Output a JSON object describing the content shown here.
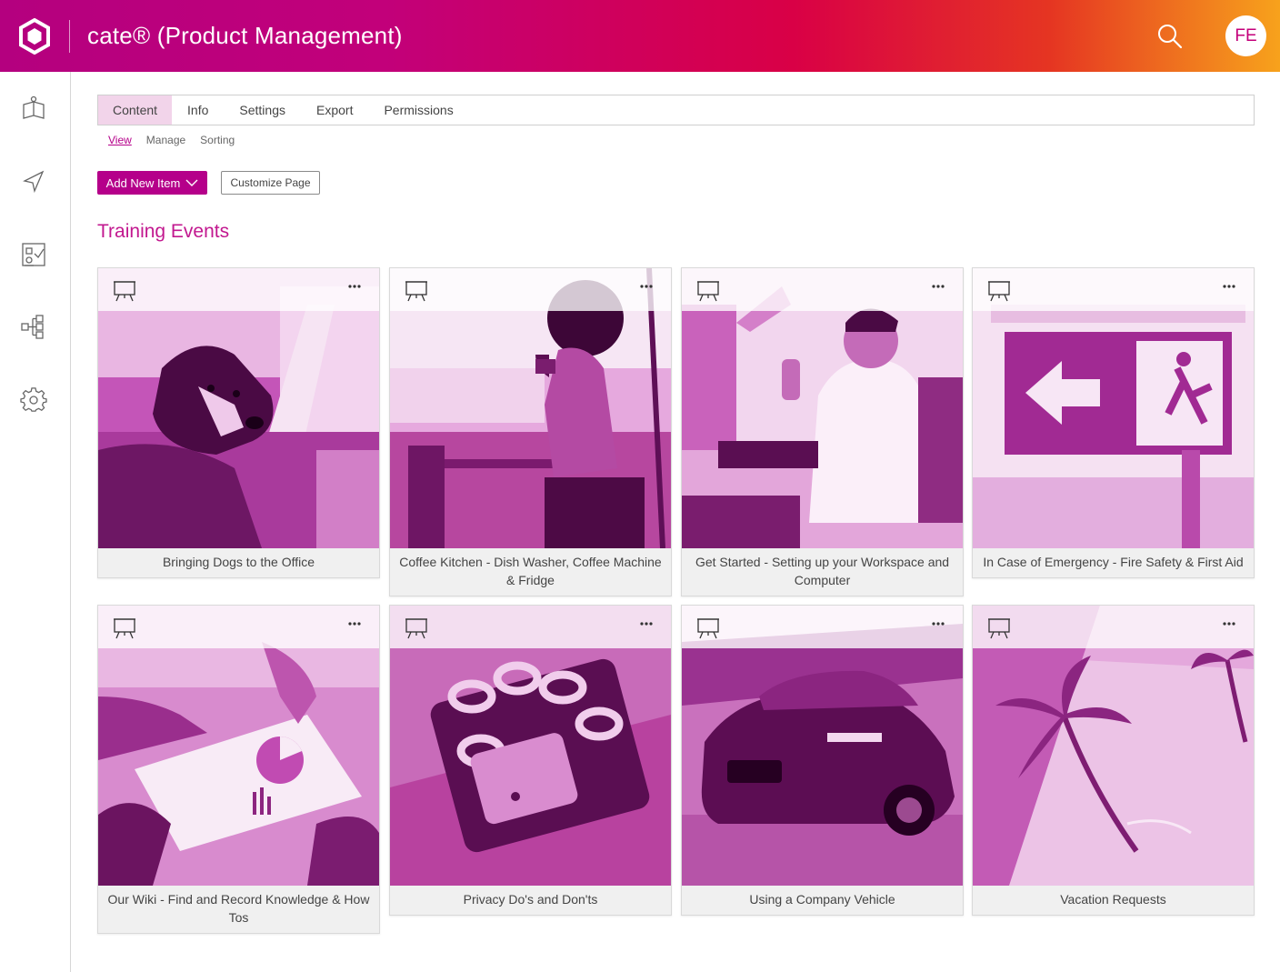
{
  "header": {
    "app_title": "cate® (Product Management)",
    "user_initials": "FE"
  },
  "sidebar": {
    "items": [
      {
        "icon": "book-icon"
      },
      {
        "icon": "navigation-arrow-icon"
      },
      {
        "icon": "checklist-icon"
      },
      {
        "icon": "hierarchy-icon"
      },
      {
        "icon": "gear-icon"
      }
    ]
  },
  "tabs": [
    "Content",
    "Info",
    "Settings",
    "Export",
    "Permissions"
  ],
  "active_tab": "Content",
  "subtabs": [
    "View",
    "Manage",
    "Sorting"
  ],
  "active_subtab": "View",
  "actions": {
    "add_new_item": "Add New Item",
    "customize_page": "Customize Page"
  },
  "section_title": "Training Events",
  "cards": [
    {
      "title": "Bringing Dogs to the Office",
      "icon": "presentation-board-icon"
    },
    {
      "title": "Coffee Kitchen - Dish Washer, Coffee Machine & Fridge",
      "icon": "presentation-board-icon"
    },
    {
      "title": "Get Started - Setting up your Workspace and Computer",
      "icon": "presentation-board-icon"
    },
    {
      "title": "In Case of Emergency - Fire Safety & First Aid",
      "icon": "presentation-board-icon"
    },
    {
      "title": "Our Wiki - Find and Record Knowledge & How Tos",
      "icon": "presentation-board-icon"
    },
    {
      "title": "Privacy Do's and Don'ts",
      "icon": "presentation-board-icon"
    },
    {
      "title": "Using a Company Vehicle",
      "icon": "presentation-board-icon"
    },
    {
      "title": "Vacation Requests",
      "icon": "presentation-board-icon"
    }
  ],
  "colors": {
    "accent": "#b5008a",
    "tab_active_bg": "#f2d4ea",
    "card_bg": "#f0f0f0"
  }
}
